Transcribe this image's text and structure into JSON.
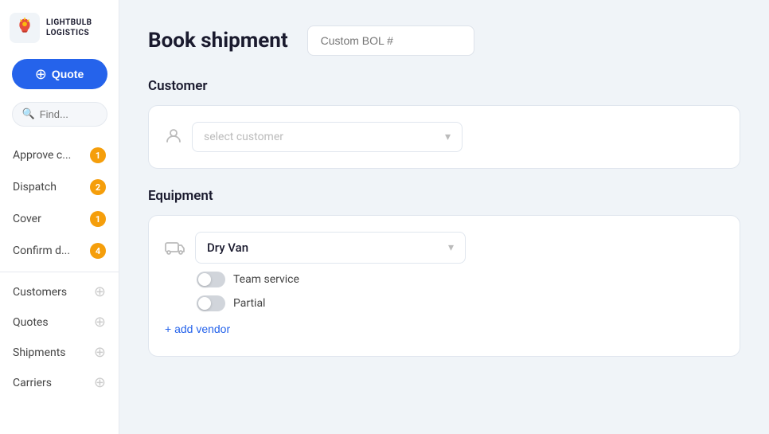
{
  "sidebar": {
    "logo_text_line1": "LIGHTBULB",
    "logo_text_line2": "LOGISTICS",
    "quote_button_label": "Quote",
    "search_placeholder": "Find...",
    "nav_items": [
      {
        "id": "approve",
        "label": "Approve c...",
        "badge": "1",
        "has_badge": true,
        "has_plus": false
      },
      {
        "id": "dispatch",
        "label": "Dispatch",
        "badge": "2",
        "has_badge": true,
        "has_plus": false
      },
      {
        "id": "cover",
        "label": "Cover",
        "badge": "1",
        "has_badge": true,
        "has_plus": false
      },
      {
        "id": "confirm",
        "label": "Confirm d...",
        "badge": "4",
        "has_badge": true,
        "has_plus": false
      },
      {
        "id": "customers",
        "label": "Customers",
        "has_badge": false,
        "has_plus": true
      },
      {
        "id": "quotes",
        "label": "Quotes",
        "has_badge": false,
        "has_plus": true
      },
      {
        "id": "shipments",
        "label": "Shipments",
        "has_badge": false,
        "has_plus": true
      },
      {
        "id": "carriers",
        "label": "Carriers",
        "has_badge": false,
        "has_plus": true
      }
    ]
  },
  "main": {
    "page_title": "Book shipment",
    "bol_placeholder": "Custom BOL #",
    "customer_section": {
      "title": "Customer",
      "select_placeholder": "select customer"
    },
    "equipment_section": {
      "title": "Equipment",
      "equipment_value": "Dry Van",
      "team_service_label": "Team service",
      "partial_label": "Partial",
      "add_vendor_label": "+ add vendor"
    }
  },
  "colors": {
    "primary_blue": "#2563eb",
    "badge_orange": "#f59e0b",
    "sidebar_bg": "#ffffff",
    "main_bg": "#f0f4f8"
  }
}
